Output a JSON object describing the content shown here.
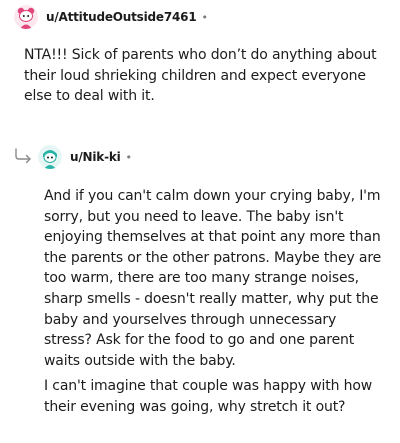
{
  "comment1": {
    "username": "u/AttitudeOutside7461",
    "separator": "•",
    "avatar_icon": "reddit-avatar-pink-icon",
    "paragraphs": [
      "NTA!!! Sick of parents who don’t do anything about their loud shrieking children and expect everyone else to deal with it."
    ]
  },
  "comment2": {
    "username": "u/Nik-ki",
    "separator": "•",
    "avatar_icon": "reddit-avatar-teal-icon",
    "reply_icon": "reply-arrow-icon",
    "paragraphs": [
      "And if you can't calm down your crying baby, I'm sorry, but you need to leave. The baby isn't enjoying themselves at that point any more than the parents or the other patrons. Maybe they are too warm, there are too many strange noises, sharp smells - doesn't really matter, why put the baby and yourselves through unnecessary stress? Ask for the food to go and one parent waits outside with the baby.",
      "I can't imagine that couple was happy with how their evening was going, why stretch it out?"
    ]
  },
  "colors": {
    "text": "#1c1c1c",
    "meta": "#7c7c7c",
    "avatar1_accent": "#e0457b",
    "avatar2_accent": "#2bb3a8"
  }
}
